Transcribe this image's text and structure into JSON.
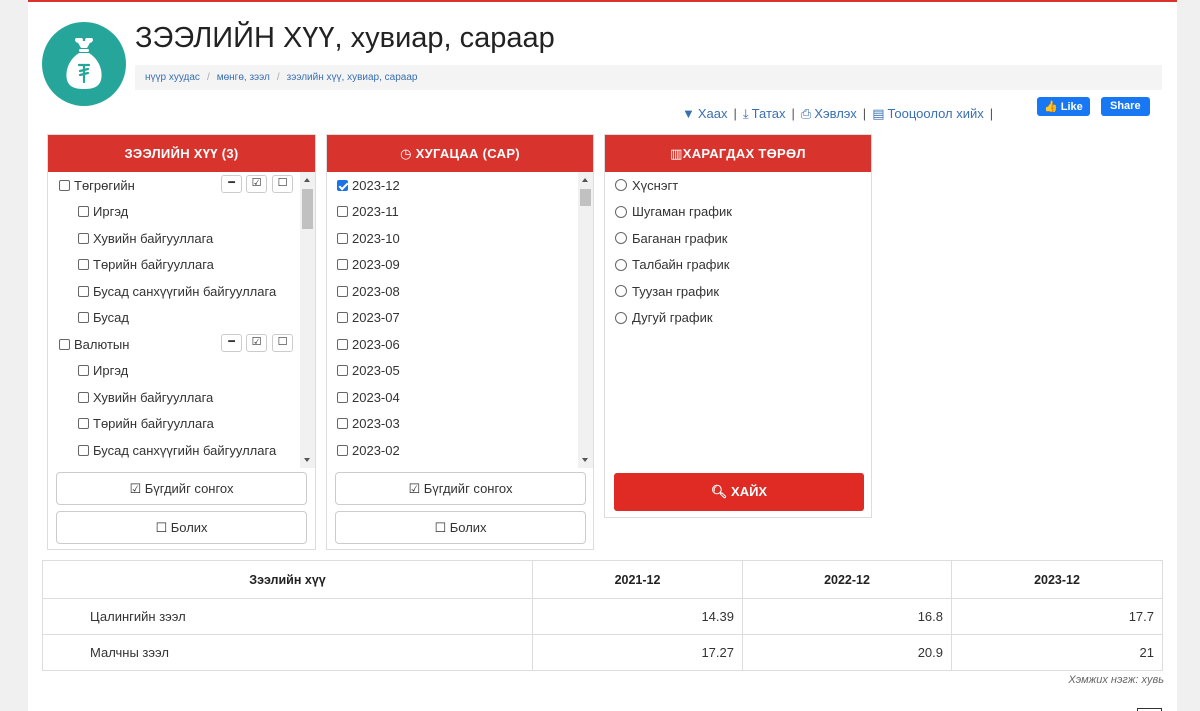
{
  "header": {
    "title": "ЗЭЭЛИЙН ХҮҮ, хувиар, сараар",
    "breadcrumb": [
      "нүүр хуудас",
      "мөнгө, зээл",
      "зээлийн хүү, хувиар, сараар"
    ]
  },
  "toolbar": {
    "close": "Хаах",
    "download": "Татах",
    "print": "Хэвлэх",
    "calc": "Тооцоолол хийх"
  },
  "facebook": {
    "like": "Like",
    "share": "Share"
  },
  "panels": {
    "indicator": {
      "title": "ЗЭЭЛИЙН ХҮҮ (3)",
      "groups": [
        {
          "label": "Төгрөгийн",
          "children": [
            "Иргэд",
            "Хувийн байгууллага",
            "Төрийн байгууллага",
            "Бусад санхүүгийн байгууллага",
            "Бусад"
          ]
        },
        {
          "label": "Валютын",
          "children": [
            "Иргэд",
            "Хувийн байгууллага",
            "Төрийн байгууллага",
            "Бусад санхүүгийн байгууллага"
          ]
        }
      ],
      "select_all": "Бүгдийг сонгох",
      "cancel": "Болих"
    },
    "time": {
      "title": "ХУГАЦАА (САР)",
      "items": [
        "2023-12",
        "2023-11",
        "2023-10",
        "2023-09",
        "2023-08",
        "2023-07",
        "2023-06",
        "2023-05",
        "2023-04",
        "2023-03",
        "2023-02"
      ],
      "checked": "2023-12",
      "select_all": "Бүгдийг сонгох",
      "cancel": "Болих"
    },
    "view": {
      "title": "ХАРАГДАХ ТӨРӨЛ",
      "options": [
        "Хүснэгт",
        "Шугаман график",
        "Баганан график",
        "Талбайн график",
        "Туузан график",
        "Дугуй график"
      ],
      "search": "ХАЙХ"
    }
  },
  "table": {
    "headers": [
      "Зээлийн хүү",
      "2021-12",
      "2022-12",
      "2023-12"
    ],
    "rows": [
      {
        "label": "Цалингийн зээл",
        "values": [
          "14.39",
          "16.8",
          "17.7"
        ]
      },
      {
        "label": "Малчны зээл",
        "values": [
          "17.27",
          "20.9",
          "21"
        ]
      }
    ],
    "unit": "Хэмжих нэгж: хувь"
  },
  "colors": {
    "accent": "#d9332d",
    "logo": "#26a69a",
    "link": "#3a6fb0",
    "facebook": "#1877f2"
  }
}
